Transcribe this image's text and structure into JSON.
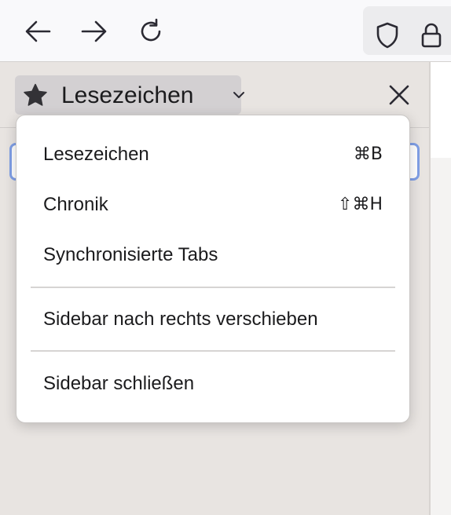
{
  "toolbar": {
    "back_icon": "arrow-left-icon",
    "forward_icon": "arrow-right-icon",
    "reload_icon": "reload-icon",
    "shield_icon": "shield-icon",
    "lock_icon": "lock-icon"
  },
  "sidebar": {
    "switcher": {
      "icon": "star-icon",
      "title": "Lesezeichen",
      "chevron": "chevron-down-icon"
    },
    "close_icon": "close-icon"
  },
  "menu": {
    "items": [
      {
        "label": "Lesezeichen",
        "shortcut": "⌘B"
      },
      {
        "label": "Chronik",
        "shortcut": "⇧⌘H"
      },
      {
        "label": "Synchronisierte Tabs",
        "shortcut": ""
      },
      {
        "label": "Sidebar nach rechts verschieben",
        "shortcut": ""
      },
      {
        "label": "Sidebar schließen",
        "shortcut": ""
      }
    ]
  },
  "colors": {
    "accent": "#7f9fe6",
    "text": "#1b1b1d",
    "sidebar_bg": "#e8e4e1",
    "toolbar_bg": "#f9f9fb"
  }
}
